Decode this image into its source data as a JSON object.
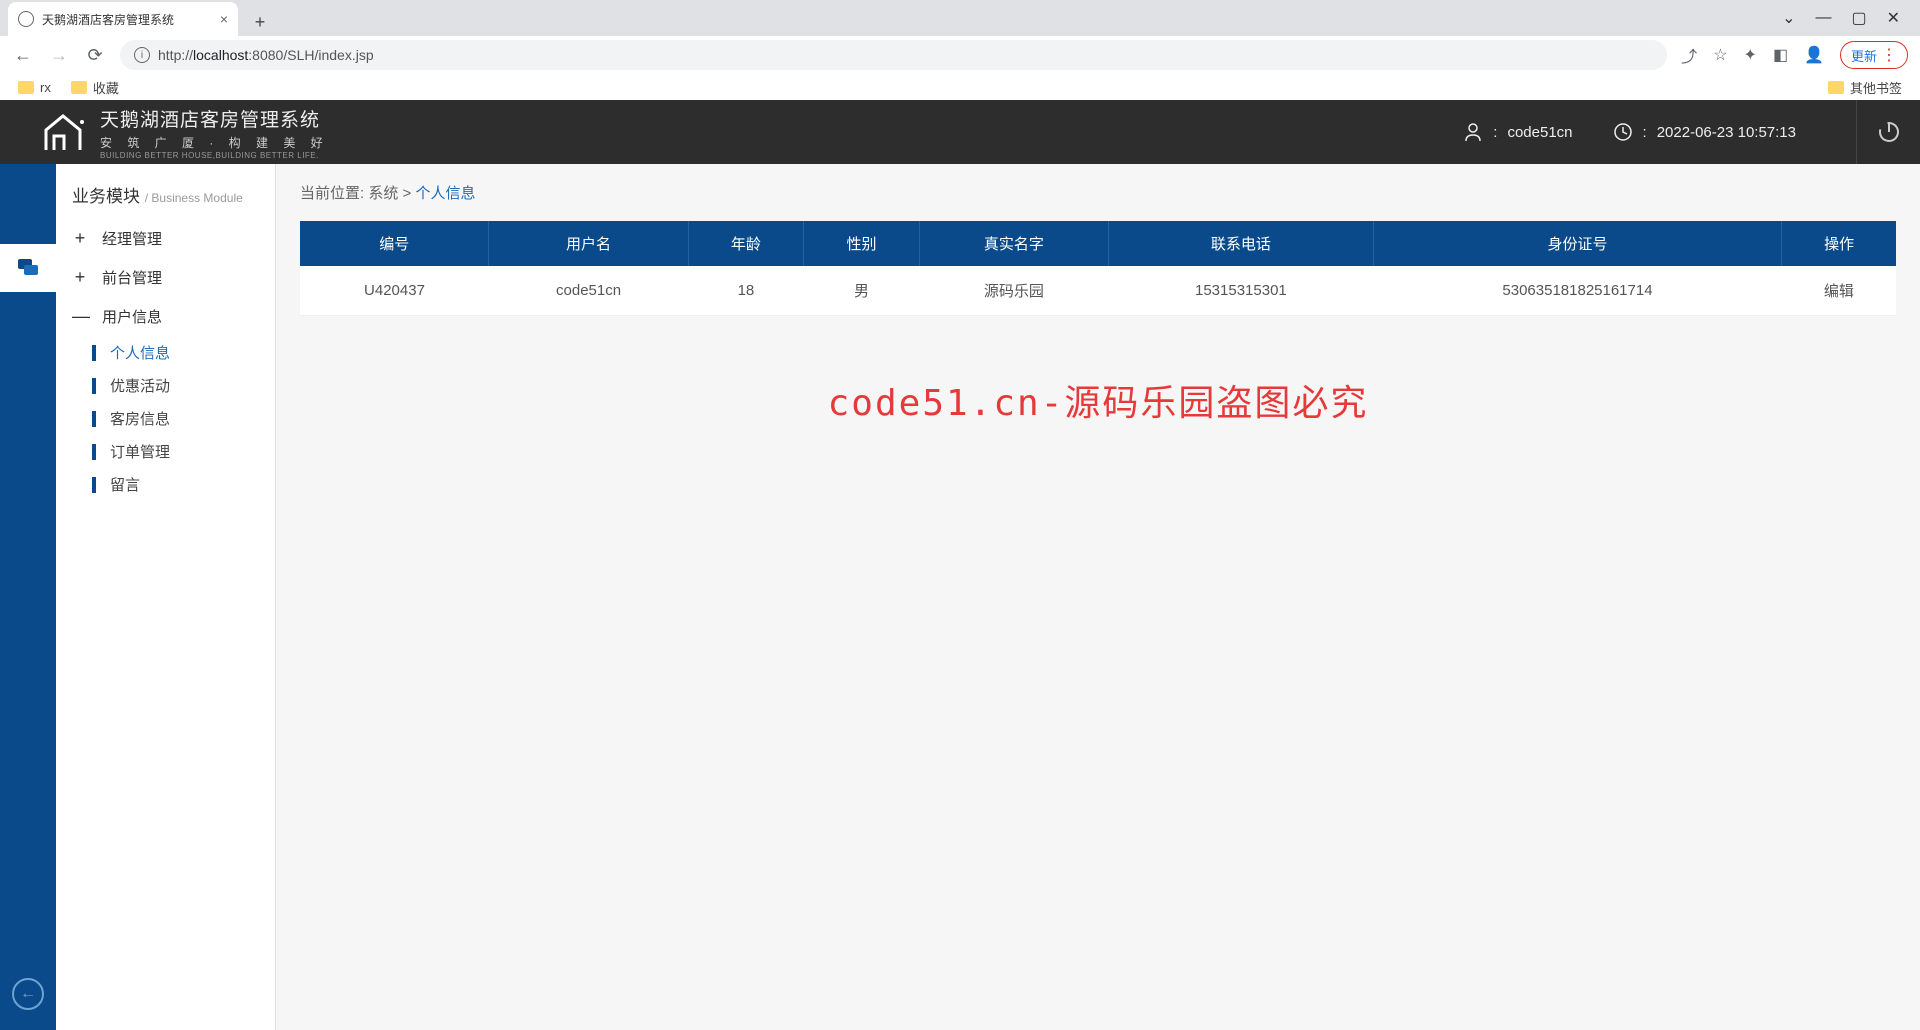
{
  "browser": {
    "tab_title": "天鹅湖酒店客房管理系统",
    "url_prefix": "http://",
    "url_host": "localhost",
    "url_port": ":8080",
    "url_path": "/SLH/index.jsp",
    "update_label": "更新",
    "bookmarks": {
      "rx": "rx",
      "fav": "收藏",
      "other": "其他书签"
    }
  },
  "header": {
    "app_title": "天鹅湖酒店客房管理系统",
    "app_sub": "安 筑 广 厦  ·  构 建 美 好",
    "app_en": "BUILDING BETTER HOUSE,BUILDING BETTER LIFE.",
    "username": "code51cn",
    "datetime": "2022-06-23 10:57:13"
  },
  "sidebar": {
    "title": "业务模块",
    "title_en": "/ Business Module",
    "items": [
      {
        "label": "经理管理"
      },
      {
        "label": "前台管理"
      },
      {
        "label": "用户信息"
      }
    ],
    "subitems": [
      {
        "label": "个人信息",
        "active": true
      },
      {
        "label": "优惠活动"
      },
      {
        "label": "客房信息"
      },
      {
        "label": "订单管理"
      },
      {
        "label": "留言"
      }
    ]
  },
  "breadcrumb": {
    "label": "当前位置:",
    "root": "系统",
    "sep": ">",
    "current": "个人信息"
  },
  "table": {
    "headers": [
      "编号",
      "用户名",
      "年龄",
      "性别",
      "真实名字",
      "联系电话",
      "身份证号",
      "操作"
    ],
    "rows": [
      {
        "id": "U420437",
        "username": "code51cn",
        "age": "18",
        "gender": "男",
        "realname": "源码乐园",
        "phone": "15315315301",
        "idcard": "530635181825161714",
        "action": "编辑"
      }
    ]
  },
  "watermark": "code51.cn-源码乐园盗图必究"
}
